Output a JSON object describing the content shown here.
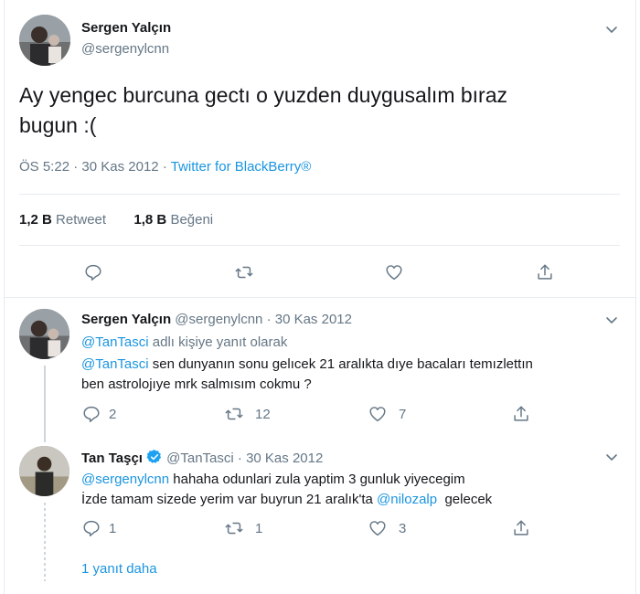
{
  "main_tweet": {
    "name": "Sergen Yalçın",
    "handle": "@sergenylcnn",
    "text_line1": "Ay yengec burcuna gectı o yuzden duygusalım bıraz",
    "text_line2": "bugun :(",
    "time": "ÖS 5:22",
    "sep": "·",
    "date": "30 Kas 2012",
    "source": "Twitter for BlackBerry®",
    "retweets_count": "1,2 B",
    "retweets_label": "Retweet",
    "likes_count": "1,8 B",
    "likes_label": "Beğeni"
  },
  "replies": [
    {
      "name": "Sergen Yalçın",
      "handle": "@sergenylcnn",
      "sep": "·",
      "date": "30 Kas 2012",
      "reply_to_mention": "@TanTasci",
      "reply_to_suffix": "adlı kişiye yanıt olarak",
      "mention": "@TanTasci",
      "text_line1_rest": "sen dunyanın sonu gelıcek 21 aralıkta dıye bacaları temızlettın",
      "text_line2": "ben astrolojıye mrk salmısım cokmu ?",
      "reply_count": "2",
      "retweet_count": "12",
      "like_count": "7"
    },
    {
      "name": "Tan Taşçı",
      "handle": "@TanTasci",
      "sep": "·",
      "date": "30 Kas 2012",
      "mention": "@sergenylcnn",
      "text_line1_rest": "hahaha odunlari zula yaptim 3 gunluk yiyecegim",
      "text_line2_pre": "İzde tamam sizede yerim var buyrun 21 aralık'ta",
      "mention2": "@nilozalp",
      "text_line2_post": "gelecek",
      "reply_count": "1",
      "retweet_count": "1",
      "like_count": "3"
    }
  ],
  "more_replies": "1 yanıt daha",
  "colors": {
    "link": "#1b95e0",
    "secondary": "#657786",
    "border": "#e6ecf0",
    "verified": "#1da1f2"
  },
  "icons": [
    "chevron-down-icon",
    "reply-icon",
    "retweet-icon",
    "like-icon",
    "share-icon",
    "verified-icon"
  ]
}
